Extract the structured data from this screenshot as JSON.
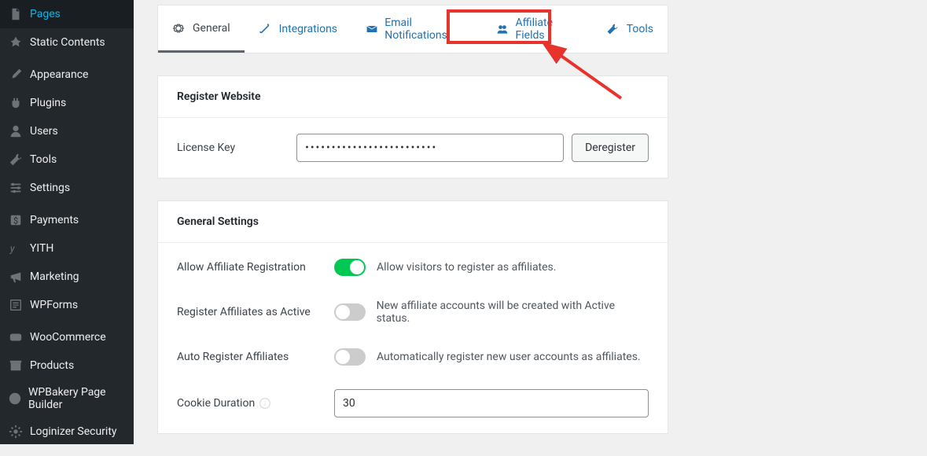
{
  "sidebar": {
    "items": [
      {
        "label": "Pages"
      },
      {
        "label": "Static Contents"
      },
      {
        "label": "Appearance"
      },
      {
        "label": "Plugins"
      },
      {
        "label": "Users"
      },
      {
        "label": "Tools"
      },
      {
        "label": "Settings"
      },
      {
        "label": "Payments"
      },
      {
        "label": "YITH"
      },
      {
        "label": "Marketing"
      },
      {
        "label": "WPForms"
      },
      {
        "label": "WooCommerce"
      },
      {
        "label": "Products"
      },
      {
        "label": "WPBakery Page Builder"
      },
      {
        "label": "Loginizer Security"
      }
    ]
  },
  "tabs": {
    "general": "General",
    "integrations": "Integrations",
    "email": "Email Notifications",
    "affiliate": "Affiliate Fields",
    "tools": "Tools"
  },
  "register_panel": {
    "title": "Register Website",
    "license_label": "License Key",
    "license_value": "•••••••••••••••••••••••••",
    "deregister": "Deregister"
  },
  "settings_panel": {
    "title": "General Settings",
    "allow_reg_label": "Allow Affiliate Registration",
    "allow_reg_desc": "Allow visitors to register as affiliates.",
    "reg_active_label": "Register Affiliates as Active",
    "reg_active_desc": "New affiliate accounts will be created with Active status.",
    "auto_reg_label": "Auto Register Affiliates",
    "auto_reg_desc": "Automatically register new user accounts as affiliates.",
    "cookie_label": "Cookie Duration",
    "cookie_value": "30"
  }
}
